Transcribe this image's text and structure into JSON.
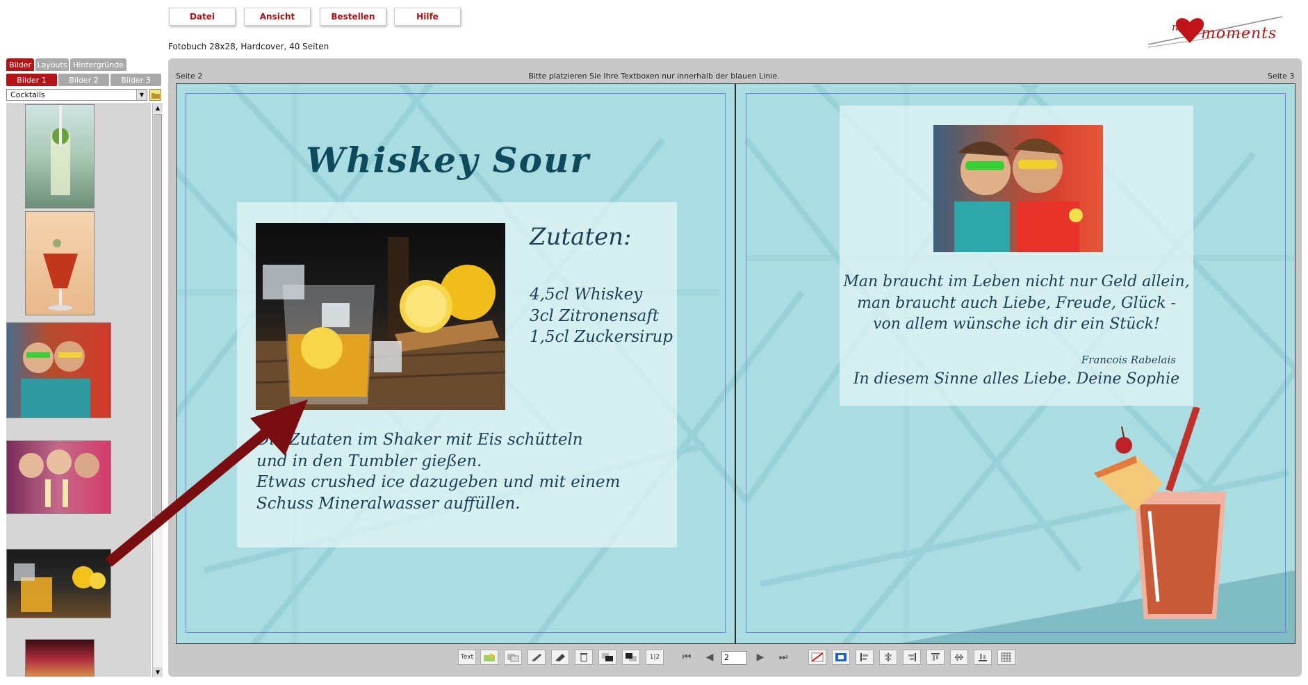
{
  "menu": {
    "datei": "Datei",
    "ansicht": "Ansicht",
    "bestellen": "Bestellen",
    "hilfe": "Hilfe"
  },
  "product_info": "Fotobuch 28x28, Hardcover, 40 Seiten",
  "logo": {
    "text_my": "my",
    "text_moments": "moments"
  },
  "left_panel": {
    "tabs": [
      "Bilder",
      "Layouts",
      "Hintergründe"
    ],
    "subtabs": [
      "Bilder 1",
      "Bilder 2",
      "Bilder 3"
    ],
    "album_select": "Cocktails"
  },
  "editor": {
    "page_left_label": "Seite 2",
    "page_right_label": "Seite 3",
    "hint": "Bitte platzieren Sie Ihre Textboxen nur innerhalb der blauen Linie."
  },
  "left_page": {
    "title": "Whiskey Sour",
    "ingredients_heading": "Zutaten:",
    "ingredients": [
      "4,5cl Whiskey",
      "3cl Zitronensaft",
      "1,5cl Zuckersirup"
    ],
    "instructions": [
      "Die Zutaten im Shaker mit Eis schütteln",
      "und in den Tumbler gießen.",
      "Etwas crushed ice dazugeben und mit einem",
      "Schuss Mineralwasser auffüllen."
    ]
  },
  "right_page": {
    "quote": [
      "Man braucht im Leben nicht nur Geld allein,",
      "man braucht auch Liebe, Freude, Glück -",
      "von allem wünsche ich dir ein Stück!"
    ],
    "author": "Francois Rabelais",
    "closing": "In diesem Sinne alles Liebe. Deine Sophie"
  },
  "toolbar": {
    "text_button": "Text",
    "page_number": "2",
    "page_order": "1|2"
  },
  "colors": {
    "accent": "#b51315",
    "page_background": "#a9dde1",
    "title": "#0f4a5c",
    "arrow": "#7a0d10"
  }
}
